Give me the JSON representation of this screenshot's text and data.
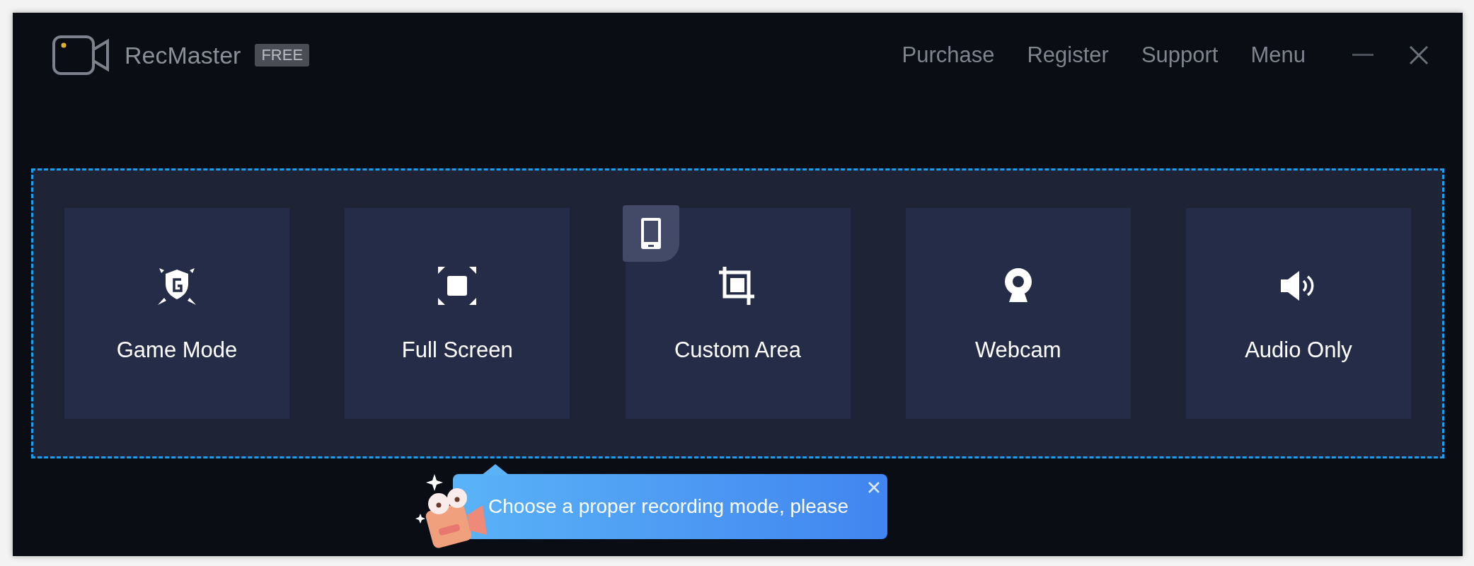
{
  "app": {
    "name": "RecMaster",
    "edition": "FREE"
  },
  "nav": [
    "Purchase",
    "Register",
    "Support",
    "Menu"
  ],
  "modes": [
    {
      "kind": "game",
      "label": "Game Mode",
      "badge": false
    },
    {
      "kind": "fullscreen",
      "label": "Full Screen",
      "badge": false
    },
    {
      "kind": "custom",
      "label": "Custom Area",
      "badge": true
    },
    {
      "kind": "webcam",
      "label": "Webcam",
      "badge": false
    },
    {
      "kind": "audio",
      "label": "Audio Only",
      "badge": false
    }
  ],
  "tip": {
    "text": "Choose a proper recording mode, please"
  }
}
